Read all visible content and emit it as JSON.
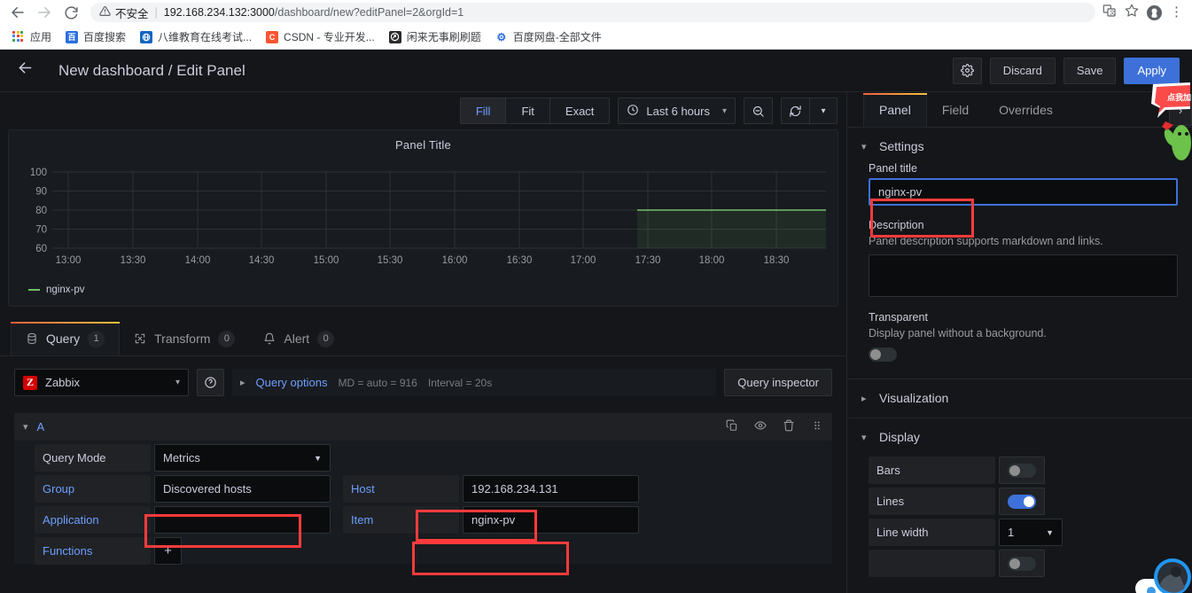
{
  "browser": {
    "nav": {
      "back": "←",
      "forward": "→",
      "reload": "⟳"
    },
    "security_label": "不安全",
    "url_host": "192.168.234.132:3000",
    "url_path": "/dashboard/new?editPanel=2&orgId=1",
    "bookmarks": [
      {
        "label": "应用",
        "icon": "apps-grid-icon",
        "color": "#4285f4"
      },
      {
        "label": "百度搜索",
        "icon": "baidu-icon",
        "color": "#2b6ede"
      },
      {
        "label": "八维教育在线考试...",
        "icon": "globe-icon",
        "color": "#1565c0"
      },
      {
        "label": "CSDN - 专业开发...",
        "icon": "csdn-icon",
        "color": "#fc5531"
      },
      {
        "label": "闲来无事刷刷题",
        "icon": "circle-arrow-icon",
        "color": "#2b2b2b"
      },
      {
        "label": "百度网盘-全部文件",
        "icon": "baidu-pan-icon",
        "color": "#2b6ede"
      }
    ],
    "toolbar_icons": [
      "translate-icon",
      "star-icon",
      "profile-avatar-icon",
      "kebab-menu-icon"
    ]
  },
  "topnav": {
    "back_icon": "back-arrow-icon",
    "title": "New dashboard / Edit Panel",
    "settings_icon": "gear-icon",
    "discard_label": "Discard",
    "save_label": "Save",
    "apply_label": "Apply"
  },
  "viz_toolbar": {
    "segments": [
      {
        "label": "Fill",
        "active": true
      },
      {
        "label": "Fit",
        "active": false
      },
      {
        "label": "Exact",
        "active": false
      }
    ],
    "time_range": "Last 6 hours",
    "clock_icon": "clock-icon",
    "zoom_out_icon": "zoom-out-icon",
    "refresh_icon": "refresh-icon",
    "refresh_caret_icon": "chevron-down-icon"
  },
  "panel": {
    "title": "Panel Title"
  },
  "chart_data": {
    "type": "area",
    "title": "Panel Title",
    "xlabel": "",
    "ylabel": "",
    "ylim": [
      60,
      100
    ],
    "yticks": [
      60,
      70,
      80,
      90,
      100
    ],
    "xticks": [
      "13:00",
      "13:30",
      "14:00",
      "14:30",
      "15:00",
      "15:30",
      "16:00",
      "16:30",
      "17:00",
      "17:30",
      "18:00",
      "18:30"
    ],
    "grid": true,
    "legend_position": "bottom-left",
    "series": [
      {
        "name": "nginx-pv",
        "color": "#73bf69",
        "fill": true,
        "x": [
          "17:24",
          "17:30",
          "18:00",
          "18:30",
          "18:55"
        ],
        "values": [
          80,
          80,
          80,
          80,
          80
        ]
      }
    ]
  },
  "query_tabs": [
    {
      "label": "Query",
      "count": "1",
      "icon": "database-icon",
      "active": true
    },
    {
      "label": "Transform",
      "count": "0",
      "icon": "transform-icon",
      "active": false
    },
    {
      "label": "Alert",
      "count": "0",
      "icon": "bell-icon",
      "active": false
    }
  ],
  "datasource_row": {
    "name": "Zabbix",
    "logo_letter": "Z",
    "help_icon": "question-circle-icon",
    "expand_icon": "chevron-right-icon",
    "query_options_label": "Query options",
    "md_text": "MD = auto = 916",
    "interval_text": "Interval = 20s",
    "query_inspector_label": "Query inspector"
  },
  "query_editor": {
    "letter": "A",
    "collapse_icon": "chevron-down-icon",
    "actions": [
      "copy-icon",
      "eye-icon",
      "trash-icon",
      "drag-handle-icon"
    ],
    "rows": [
      {
        "label": "Query Mode",
        "value": "Metrics",
        "type": "select",
        "highlight": false
      },
      {
        "label": "Group",
        "value": "Discovered hosts",
        "type": "text",
        "highlight": true
      },
      {
        "label": "Application",
        "value": "",
        "type": "text",
        "highlight": false
      },
      {
        "label": "Functions",
        "value": "",
        "type": "plus",
        "highlight": false
      }
    ],
    "right_rows": [
      {
        "label": "Host",
        "value": "192.168.234.131",
        "highlight": true
      },
      {
        "label": "Item",
        "value": "nginx-pv",
        "highlight": true
      }
    ]
  },
  "options_pane": {
    "tabs": [
      {
        "label": "Panel",
        "active": true
      },
      {
        "label": "Field",
        "active": false
      },
      {
        "label": "Overrides",
        "active": false
      }
    ],
    "expand_icon": "chevron-right-icon",
    "settings": {
      "section_label": "Settings",
      "panel_title_label": "Panel title",
      "panel_title_value": "nginx-pv",
      "description_label": "Description",
      "description_placeholder": "Panel description supports markdown and links.",
      "transparent_label": "Transparent",
      "transparent_sub": "Display panel without a background.",
      "transparent_on": false
    },
    "visualization_label": "Visualization",
    "display": {
      "section_label": "Display",
      "rows": [
        {
          "label": "Bars",
          "control": "toggle",
          "value": "off"
        },
        {
          "label": "Lines",
          "control": "toggle",
          "value": "on"
        },
        {
          "label": "Line width",
          "control": "select",
          "value": "1"
        }
      ]
    }
  },
  "overlays": {
    "mascot_bubble_text": "点我加",
    "mascot_icon": "cactus-mascot-icon",
    "chat_avatar_icon": "chat-avatar-icon"
  },
  "colors": {
    "accent_blue": "#3d71d9",
    "link_blue": "#6e9fff",
    "series_green": "#73bf69",
    "annotation_red": "#fb3b3b",
    "panel_bg": "#181b1f",
    "app_bg": "#141619"
  }
}
